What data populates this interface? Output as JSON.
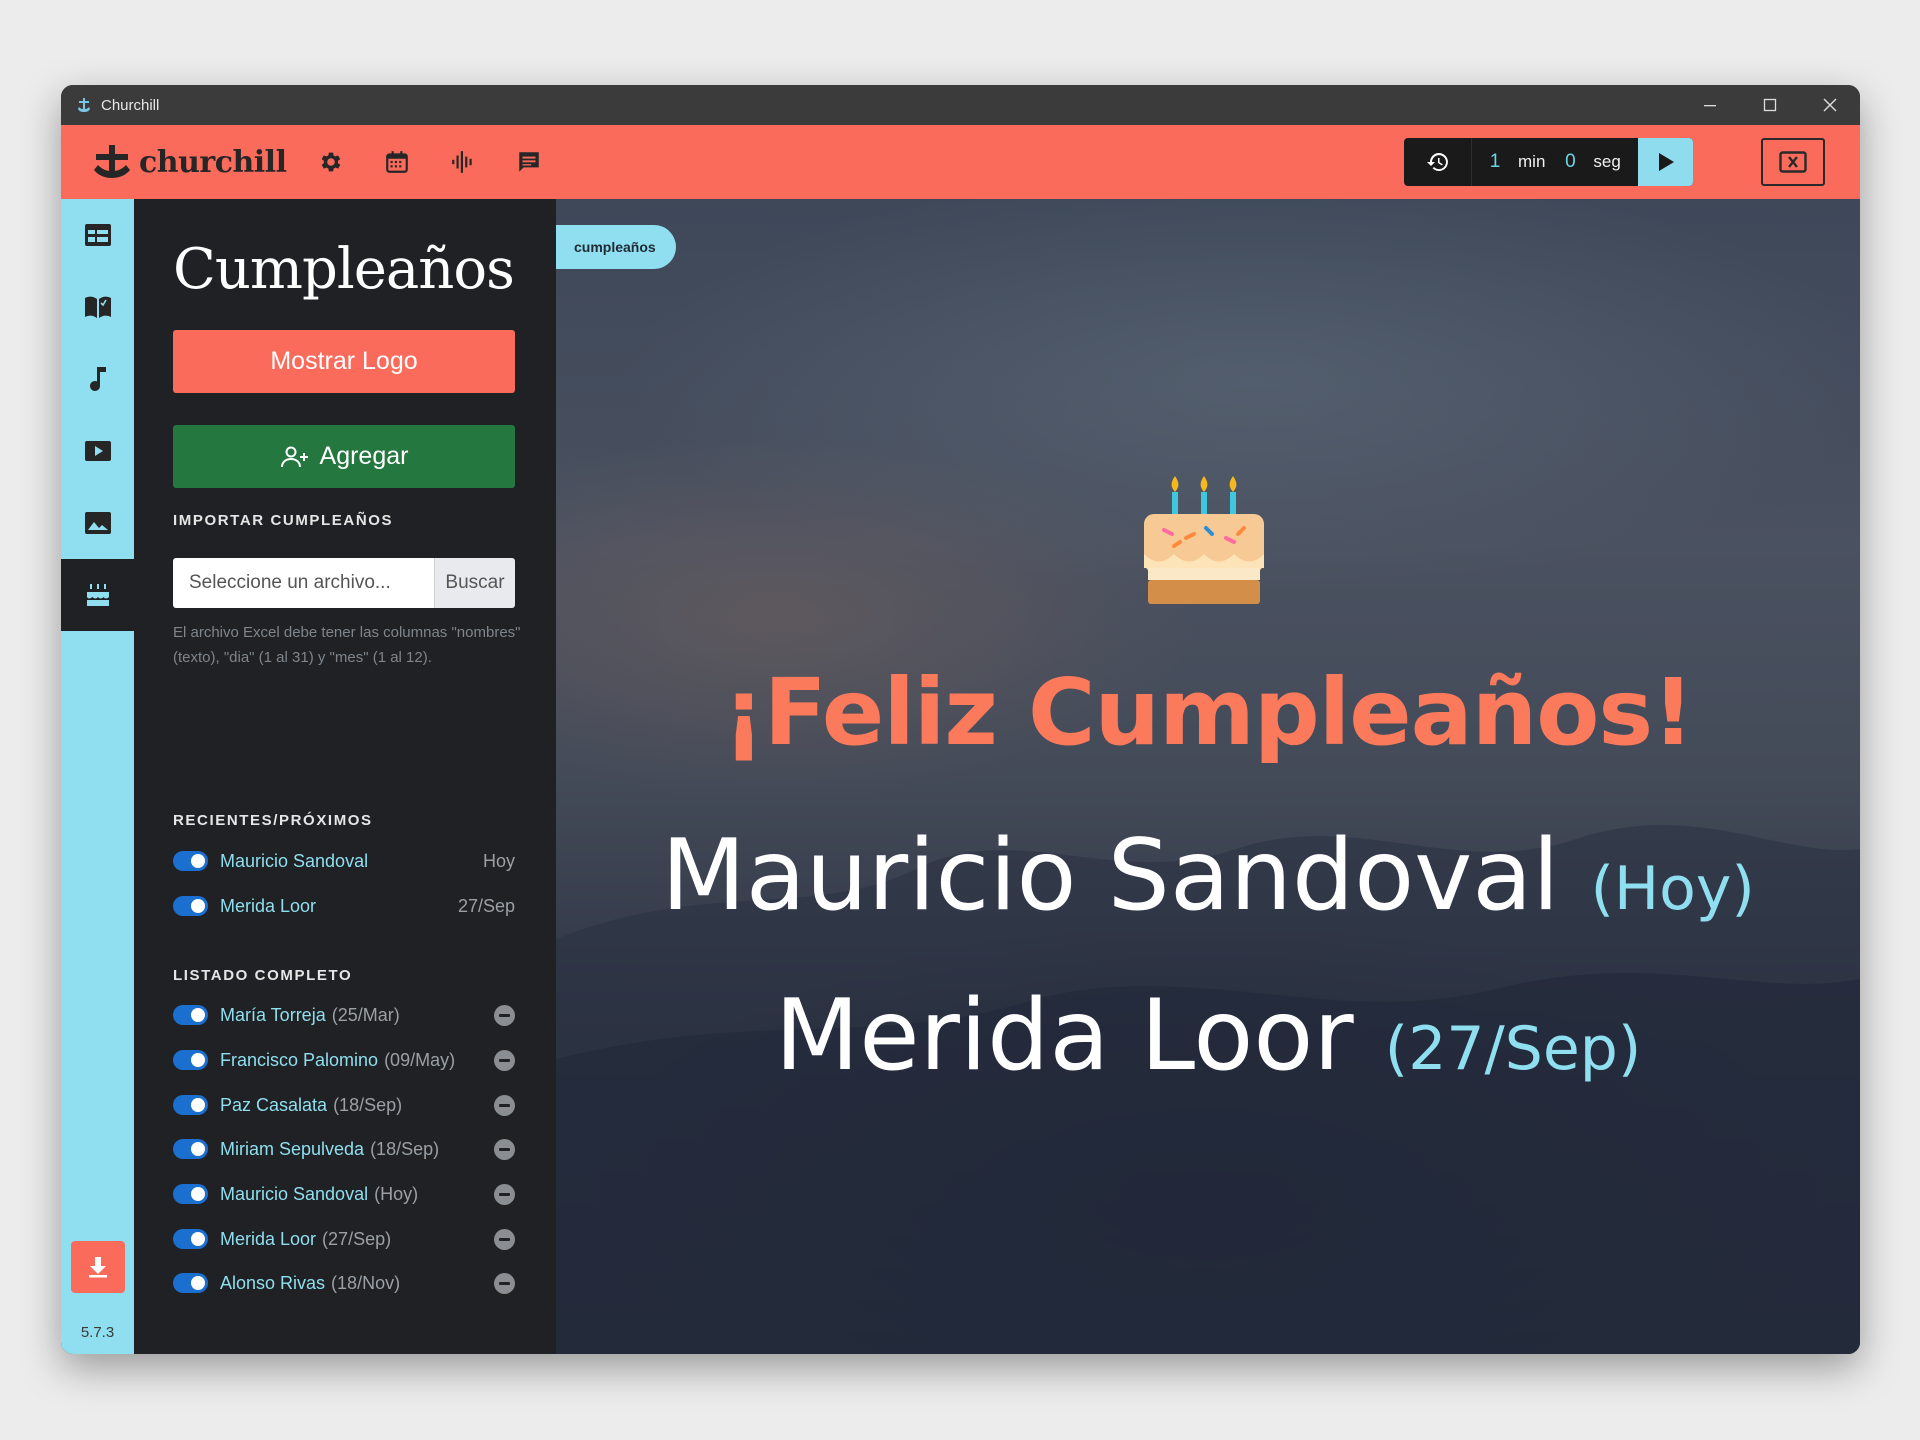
{
  "window": {
    "title": "Churchill"
  },
  "topbar": {
    "brand": "churchill",
    "icons": [
      "gear-icon",
      "calendar-icon",
      "audio-wave-icon",
      "message-icon"
    ],
    "timer": {
      "minutes": "1",
      "minutes_unit": "min",
      "seconds": "0",
      "seconds_unit": "seg"
    }
  },
  "sidebar": {
    "items": [
      {
        "icon": "table-icon"
      },
      {
        "icon": "bible-icon"
      },
      {
        "icon": "music-note-icon"
      },
      {
        "icon": "video-icon"
      },
      {
        "icon": "image-icon"
      },
      {
        "icon": "cake-icon",
        "active": true
      }
    ],
    "version": "5.7.3"
  },
  "panel": {
    "title": "Cumpleaños",
    "show_logo_label": "Mostrar Logo",
    "add_label": "Agregar",
    "import": {
      "label": "IMPORTAR CUMPLEAÑOS",
      "placeholder": "Seleccione un archivo...",
      "browse_label": "Buscar",
      "help": "El archivo Excel debe tener las columnas \"nombres\" (texto), \"dia\" (1 al 31) y \"mes\" (1 al 12)."
    },
    "recent": {
      "label": "RECIENTES/PRÓXIMOS",
      "items": [
        {
          "name": "Mauricio Sandoval",
          "when": "Hoy"
        },
        {
          "name": "Merida Loor",
          "when": "27/Sep"
        }
      ]
    },
    "full": {
      "label": "LISTADO COMPLETO",
      "items": [
        {
          "name": "María Torreja",
          "date": "(25/Mar)"
        },
        {
          "name": "Francisco Palomino",
          "date": "(09/May)"
        },
        {
          "name": "Paz Casalata",
          "date": "(18/Sep)"
        },
        {
          "name": "Miriam Sepulveda",
          "date": "(18/Sep)"
        },
        {
          "name": "Mauricio Sandoval",
          "date": "(Hoy)"
        },
        {
          "name": "Merida Loor",
          "date": "(27/Sep)"
        },
        {
          "name": "Alonso Rivas",
          "date": "(18/Nov)"
        }
      ]
    }
  },
  "preview": {
    "tag": "cumpleaños",
    "headline": "¡Feliz Cumpleaños!",
    "people": [
      {
        "name": "Mauricio Sandoval",
        "when": "(Hoy)"
      },
      {
        "name": "Merida Loor",
        "when": "(27/Sep)"
      }
    ]
  },
  "colors": {
    "accent": "#fb6b5c",
    "sidebar": "#8fdff0",
    "panel": "#1f2124",
    "add_button": "#23773f",
    "link": "#8fdff0",
    "headline": "#fb7a5c"
  }
}
